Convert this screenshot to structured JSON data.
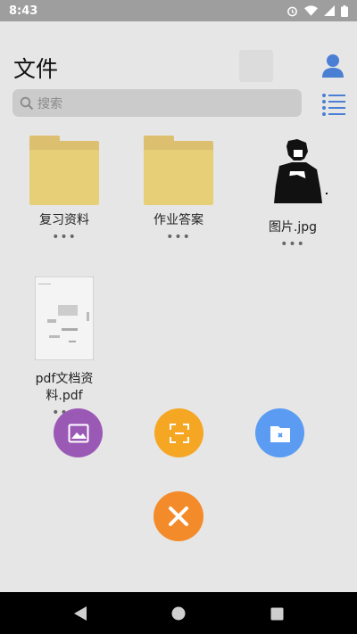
{
  "status_bar": {
    "time": "8:43"
  },
  "header": {
    "title": "文件"
  },
  "search": {
    "placeholder": "搜索"
  },
  "files": [
    {
      "name": "复习资料",
      "type": "folder",
      "more": "•••"
    },
    {
      "name": "作业答案",
      "type": "folder",
      "more": "•••"
    },
    {
      "name": "图片.jpg",
      "type": "image",
      "more": "•••"
    },
    {
      "name": "pdf文档资料.pdf",
      "type": "pdf",
      "more": "•••"
    }
  ],
  "fab_menu": {
    "colors": {
      "image": "#9b59b6",
      "scan": "#f5a623",
      "folder": "#5b9cf2",
      "close": "#f48b2a"
    }
  },
  "colors": {
    "accent_blue": "#4a7fd4",
    "folder": "#e7cf77"
  }
}
